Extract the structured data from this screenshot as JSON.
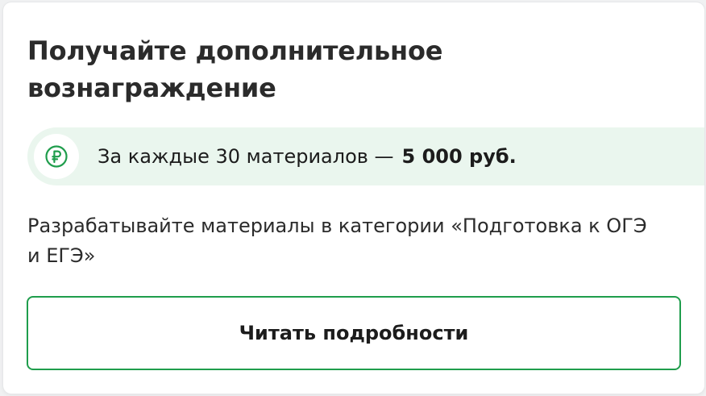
{
  "card": {
    "title": "Получайте дополнительное вознаграждение",
    "reward": {
      "icon": "ruble-icon",
      "text": "За каждые 30 материалов —",
      "amount": "5 000 руб."
    },
    "description": "Разрабатывайте материалы в категории «Подготовка к ОГЭ и ЕГЭ»",
    "button_label": "Читать подробности"
  },
  "colors": {
    "accent": "#1f9d4c",
    "banner_background": "#eaf6ee",
    "text": "#1c1c1c"
  }
}
